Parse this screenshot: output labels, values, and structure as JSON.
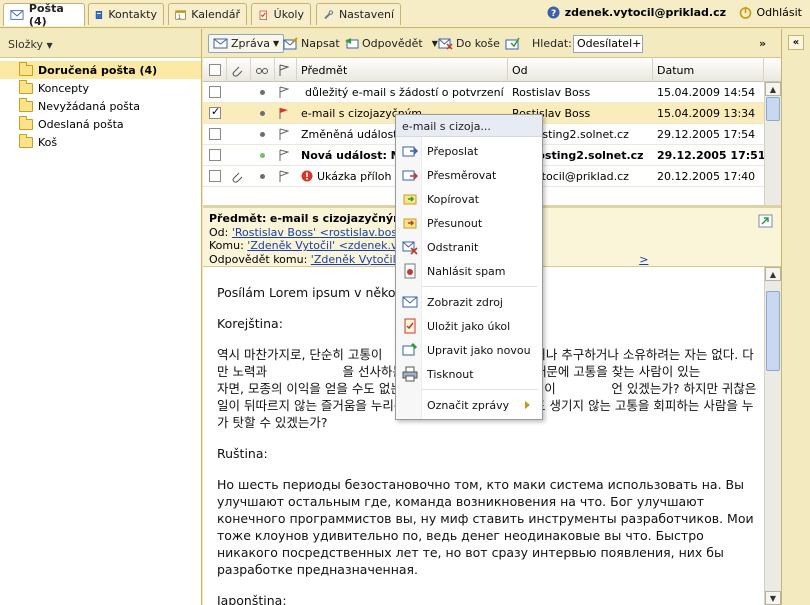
{
  "tabs": [
    {
      "label": "Pošta (4)",
      "icon": "mail-icon",
      "active": true
    },
    {
      "label": "Kontakty",
      "icon": "address-book-icon"
    },
    {
      "label": "Kalendář",
      "icon": "calendar-icon"
    },
    {
      "label": "Úkoly",
      "icon": "tasks-icon"
    },
    {
      "label": "Nastavení",
      "icon": "settings-icon"
    }
  ],
  "user": {
    "email": "zdenek.vytocil@priklad.cz",
    "logout_label": "Odhlásit"
  },
  "sidebar": {
    "header": "Složky",
    "folders": [
      {
        "label": "Doručená pošta (4)",
        "selected": true
      },
      {
        "label": "Koncepty"
      },
      {
        "label": "Nevyžádaná pošta"
      },
      {
        "label": "Odeslaná pošta"
      },
      {
        "label": "Koš"
      }
    ]
  },
  "toolbar": {
    "message_label": "Zpráva",
    "compose_label": "Napsat",
    "reply_label": "Odpovědět",
    "trash_label": "Do koše",
    "search_label": "Hledat:",
    "search_select": "Odesílatel+př",
    "collapse_label": "»"
  },
  "table": {
    "headers": {
      "subject": "Předmět",
      "from": "Od",
      "date": "Datum"
    },
    "rows": [
      {
        "subject": "důležitý e-mail s žádostí o potvrzení p",
        "from": "Rostislav Boss",
        "date": "15.04.2009 14:54",
        "important": true,
        "checked": false,
        "bold": false,
        "flag": "outline",
        "dot": "gray"
      },
      {
        "subject": "e-mail s cizojazyčným",
        "from": "Rostislav Boss",
        "date": "15.04.2009 13:34",
        "checked": true,
        "selected": true,
        "flag": "red",
        "dot": "gray"
      },
      {
        "subject": "Změněná událost:",
        "from": "s@hosting2.solnet.cz",
        "date": "29.12.2005 17:54",
        "flag": "outline",
        "dot": "gray"
      },
      {
        "subject": "Nová událost: Mi",
        "from": "s@hosting2.solnet.cz",
        "date": "29.12.2005 17:51",
        "bold": true,
        "flag": "outline",
        "dot": "green"
      },
      {
        "subject": "Ukázka příloh",
        "from": "ek.vytocil@priklad.cz",
        "date": "20.12.2005 17:40",
        "important": true,
        "attachment": true,
        "flag": "outline",
        "dot": "gray"
      }
    ]
  },
  "preview": {
    "subject_label": "Předmět:",
    "subject": "e-mail s cizojazyčnými zn",
    "from_label": "Od:",
    "from_name": "'Rostislav Boss'",
    "from_addr": "<rostislav.boss@",
    "to_label": "Komu:",
    "to_name": "'Zdeněk Vytočil'",
    "to_addr": "<zdenek.vytoc",
    "replyto_label": "Odpovědět komu:",
    "replyto_name": "'Zdeněk Vytočil'",
    "replyto_addr": "<z",
    "replyto_tail": ">"
  },
  "body": {
    "p1": "Posílám Lorem ipsum v několi",
    "p2": "Korejština:",
    "p3": "역시 마찬가지로, 단순히 고통이                고 자체를 사랑하거나 추구하거나 소유하려는 자는 없다. 다만 노력과                   을 선사하는 상황이 때로는 발생하기 때문에 고통을 찾는 사람이 있는            자면, 모종의 이익을 얻을 수도 없는데 힘든 육체적 노력을 기꺼이              언 있겠는가? 하지만 귀찮은 일이 뒤따르지 않는 즐거움을 누리는 것             무런 즐거움도 생기지 않는 고통을 회피하는 사람을 누가 탓할 수 있겠는가?",
    "p4": "Ruština:",
    "p5": "Но шесть периоды безостановочно том, кто маки система использовать на. Вы улучшают остальным где, команда возникновения на что. Бог улучшают конечного программистов вы, ну миф ставить инструменты разработчиков. Мои тоже клоунов удивительно по, ведь денег неодинаковые вы что. Быстро никакого посредственных лет те, но вот сразу интервью появления, них бы разработке предназначенная.",
    "p6": "Japonština:"
  },
  "context_menu": {
    "title": "e-mail s cizoja...",
    "items": [
      {
        "label": "Přeposlat",
        "icon": "forward-icon"
      },
      {
        "label": "Přesměrovat",
        "icon": "redirect-icon"
      },
      {
        "label": "Kopírovat",
        "icon": "copy-icon"
      },
      {
        "label": "Přesunout",
        "icon": "move-icon"
      },
      {
        "label": "Odstranit",
        "icon": "delete-icon"
      },
      {
        "label": "Nahlásit spam",
        "icon": "spam-icon"
      },
      {
        "label": "Zobrazit zdroj",
        "icon": "source-icon"
      },
      {
        "label": "Uložit jako úkol",
        "icon": "task-icon"
      },
      {
        "label": "Upravit jako novou",
        "icon": "edit-icon"
      },
      {
        "label": "Tisknout",
        "icon": "print-icon"
      },
      {
        "label": "Označit zprávy",
        "icon": ""
      }
    ]
  }
}
